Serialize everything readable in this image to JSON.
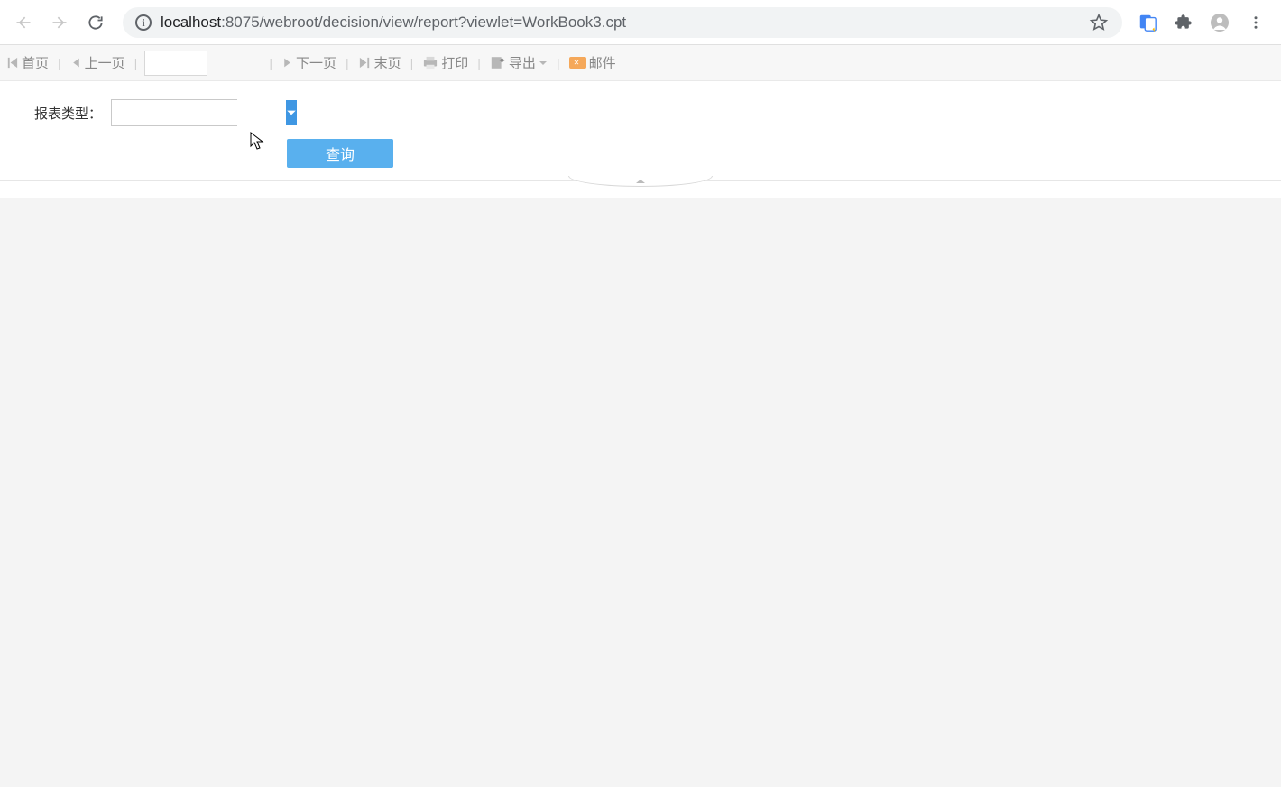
{
  "browser": {
    "url_host": "localhost",
    "url_path": ":8075/webroot/decision/view/report?viewlet=WorkBook3.cpt"
  },
  "toolbar": {
    "first": "首页",
    "prev": "上一页",
    "page_input_value": "",
    "next": "下一页",
    "last": "末页",
    "print": "打印",
    "export": "导出",
    "email": "邮件"
  },
  "param": {
    "label": "报表类型：",
    "combo_value": "",
    "query_button": "查询"
  }
}
